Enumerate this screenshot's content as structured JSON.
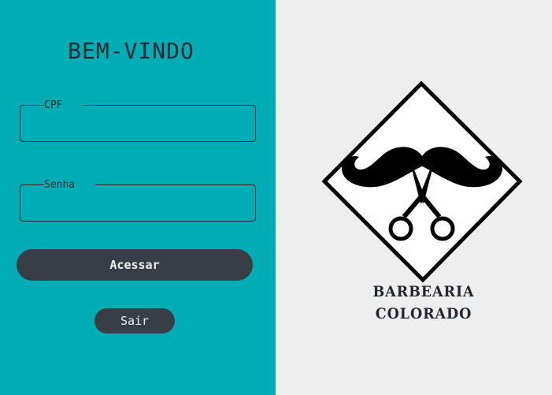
{
  "login": {
    "title": "BEM-VINDO",
    "cpf": {
      "label": "CPF",
      "value": "",
      "placeholder": ""
    },
    "senha": {
      "label": "Senha",
      "value": "",
      "placeholder": ""
    },
    "acessar_label": "Acessar",
    "sair_label": "Sair"
  },
  "brand": {
    "line1": "BARBEARIA",
    "line2": "COLORADO",
    "logo_icon": "mustache-scissors-icon"
  },
  "colors": {
    "primary": "#00adb5",
    "background": "#eeeeee",
    "button": "#393e46",
    "text": "#222831"
  }
}
